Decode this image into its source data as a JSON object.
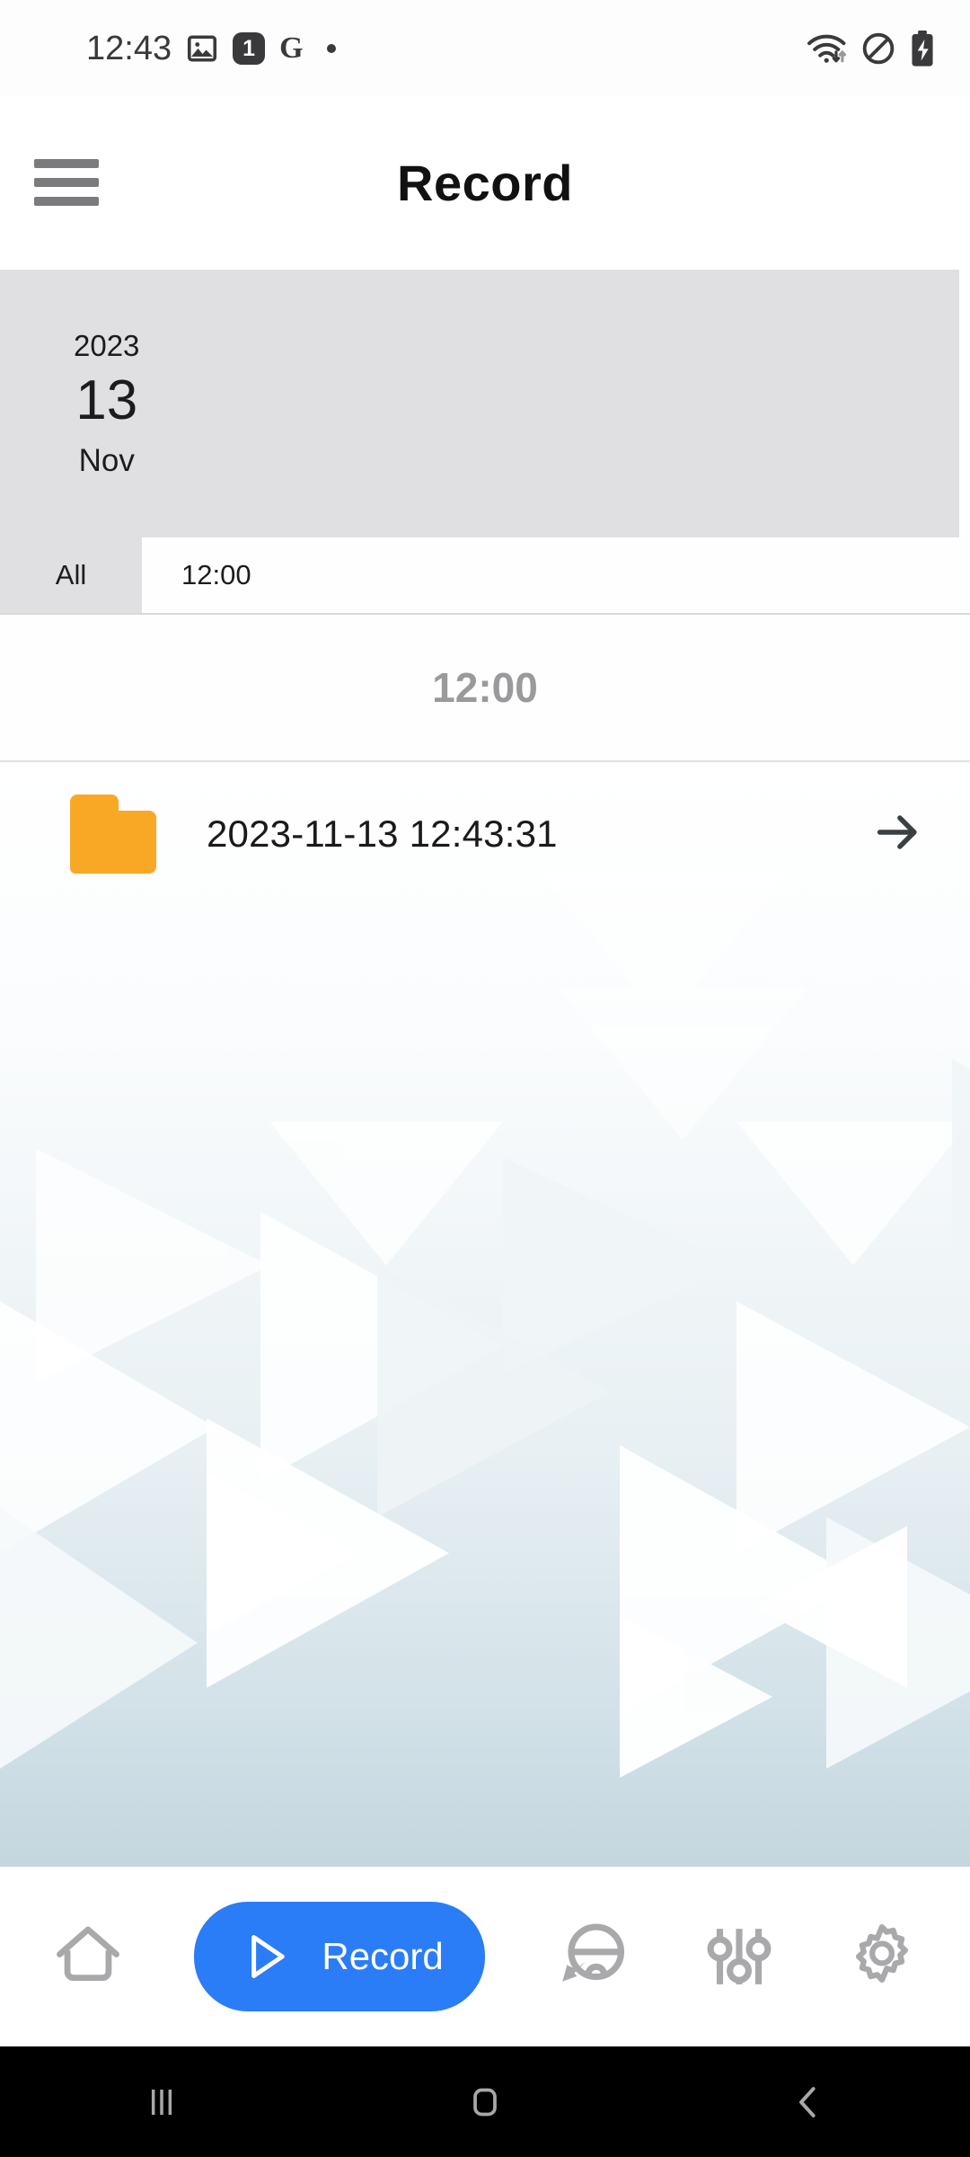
{
  "status_bar": {
    "time": "12:43",
    "notification_badge": "1",
    "google_glyph": "G",
    "icons": [
      "gallery-image-icon",
      "notification-count-badge",
      "google-icon",
      "dot-indicator",
      "wifi-icon",
      "do-not-disturb-icon",
      "battery-charging-icon"
    ]
  },
  "header": {
    "title": "Record",
    "menu_icon": "hamburger-menu-icon"
  },
  "date_card": {
    "year": "2023",
    "day": "13",
    "month": "Nov",
    "background": "#e0e0e2"
  },
  "tabs": [
    {
      "label": "All",
      "selected": false
    },
    {
      "label": "12:00",
      "selected": true
    }
  ],
  "section": {
    "header": "12:00"
  },
  "files": [
    {
      "icon": "folder-icon",
      "icon_color": "#f9a826",
      "name": "2023-11-13 12:43:31",
      "action_icon": "arrow-right-icon"
    }
  ],
  "bottom_nav": {
    "items": [
      {
        "label": "",
        "icon": "home-icon",
        "selected": false
      },
      {
        "label": "Record",
        "icon": "play-triangle-icon",
        "selected": true
      },
      {
        "label": "",
        "icon": "steering-wheel-icon",
        "selected": false
      },
      {
        "label": "",
        "icon": "sliders-equalizer-icon",
        "selected": false
      },
      {
        "label": "",
        "icon": "gear-settings-icon",
        "selected": false
      }
    ],
    "accent_color": "#2B7CF7",
    "inactive_color": "#a9a9ac"
  },
  "android_nav": {
    "recents_icon": "recents-icon",
    "home_icon": "home-square-icon",
    "back_icon": "back-chevron-icon"
  }
}
